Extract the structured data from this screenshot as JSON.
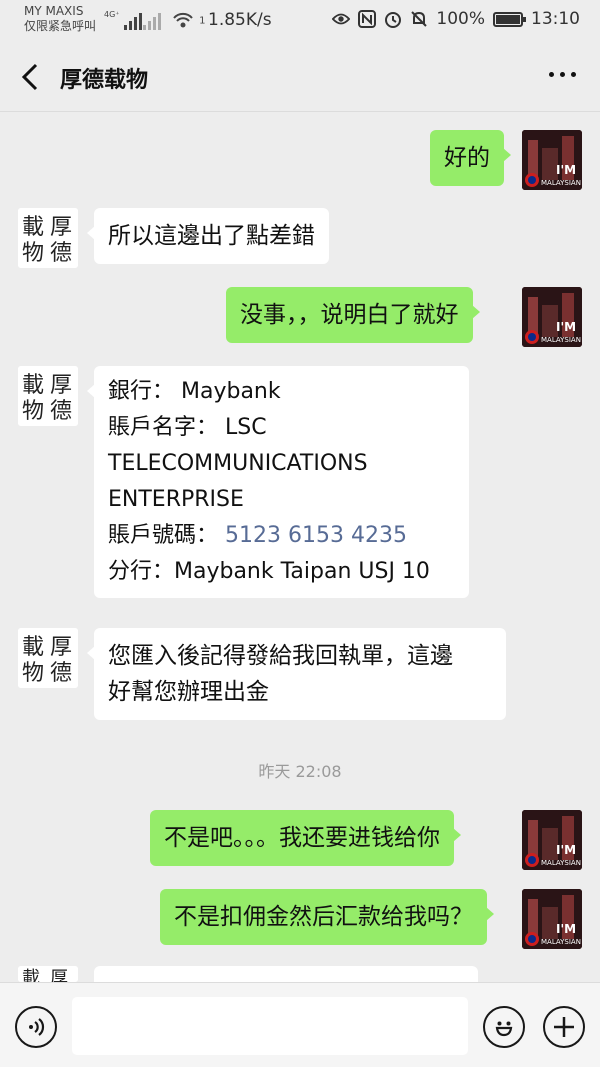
{
  "status_bar": {
    "carrier_line1": "MY MAXIS",
    "carrier_line2": "仅限紧急呼叫",
    "network_label": "4G⁺",
    "wifi_sub": "1",
    "speed": "1.85K/s",
    "battery_percent": "100%",
    "time": "13:10",
    "icons": [
      "eye-icon",
      "nfc-icon",
      "alarm-icon",
      "mute-icon",
      "battery-charging-icon"
    ]
  },
  "header": {
    "title": "厚德载物",
    "back_icon": "chevron-left-icon",
    "more_icon": "more-dots-icon"
  },
  "messages": [
    {
      "side": "right",
      "text": "好的"
    },
    {
      "side": "left",
      "text": "所以這邊出了點差錯"
    },
    {
      "side": "right",
      "text": "没事，，说明白了就好"
    },
    {
      "side": "left",
      "lines": [
        "銀行： Maybank",
        "賬戶名字： LSC",
        "TELECOMMUNICATIONS",
        "ENTERPRISE",
        "賬戶號碼： ",
        "分行：Maybank Taipan USJ 10"
      ],
      "account_number": "5123 6153 4235"
    },
    {
      "side": "left",
      "lines": [
        "您匯入後記得發給我回執單，這邊",
        "好幫您辦理出金"
      ]
    },
    {
      "side": "right",
      "text": "不是吧。。。我还要进钱给你"
    },
    {
      "side": "right",
      "text": "不是扣佣金然后汇款给我吗？"
    }
  ],
  "timestamp": "昨天 22:08",
  "avatar_me_text": "I'M\nMALAYSIAN",
  "input_bar": {
    "placeholder": "",
    "voice_icon": "voice-icon",
    "emoji_icon": "emoji-icon",
    "plus_icon": "plus-icon"
  },
  "colors": {
    "background": "#ededed",
    "sent_bubble": "#95ec69",
    "received_bubble": "#ffffff",
    "link": "#576b95"
  }
}
